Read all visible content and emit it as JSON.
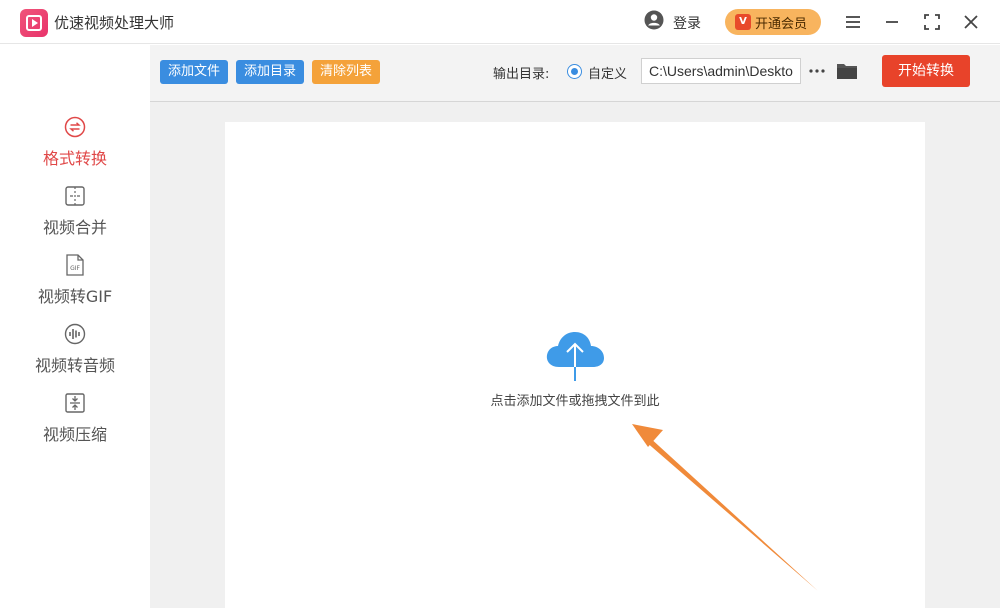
{
  "app": {
    "title": "优速视频处理大师"
  },
  "header": {
    "login_label": "登录",
    "vip_label": "开通会员"
  },
  "sidebar": {
    "items": [
      {
        "label": "格式转换",
        "icon": "format-convert-icon",
        "active": true
      },
      {
        "label": "视频合并",
        "icon": "video-merge-icon",
        "active": false
      },
      {
        "label": "视频转GIF",
        "icon": "gif-icon",
        "active": false
      },
      {
        "label": "视频转音频",
        "icon": "audio-icon",
        "active": false
      },
      {
        "label": "视频压缩",
        "icon": "compress-icon",
        "active": false
      }
    ]
  },
  "toolbar": {
    "add_file": "添加文件",
    "add_dir": "添加目录",
    "clear_list": "清除列表",
    "output_label": "输出目录:",
    "radio_label": "自定义",
    "output_path": "C:\\Users\\admin\\Deskto",
    "start_label": "开始转换"
  },
  "main": {
    "drop_hint": "点击添加文件或拖拽文件到此"
  },
  "colors": {
    "accent_red": "#e8432a",
    "accent_blue": "#3a8de0",
    "accent_orange": "#f4a23a",
    "vip": "#f8b45e",
    "cloud": "#3f9be8",
    "arrow": "#f08a3a"
  }
}
